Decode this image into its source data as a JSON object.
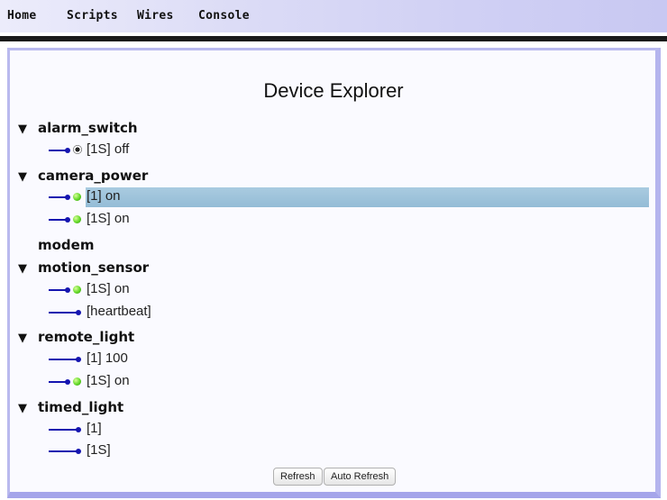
{
  "nav": {
    "items": [
      "Home",
      "Scripts",
      "Wires",
      "Console"
    ]
  },
  "page": {
    "title": "Device Explorer"
  },
  "devices": [
    {
      "name": "alarm_switch",
      "expanded": true,
      "channels": [
        {
          "label": "[1S] off",
          "indicator": "radio",
          "selected": false
        }
      ]
    },
    {
      "name": "camera_power",
      "expanded": true,
      "channels": [
        {
          "label": "[1] on",
          "indicator": "green",
          "selected": true
        },
        {
          "label": "[1S] on",
          "indicator": "green",
          "selected": false
        }
      ]
    },
    {
      "name": "modem",
      "expanded": false,
      "channels": []
    },
    {
      "name": "motion_sensor",
      "expanded": true,
      "channels": [
        {
          "label": "[1S] on",
          "indicator": "green",
          "selected": false
        },
        {
          "label": "[heartbeat]",
          "indicator": "none",
          "selected": false
        }
      ]
    },
    {
      "name": "remote_light",
      "expanded": true,
      "channels": [
        {
          "label": "[1] 100",
          "indicator": "none",
          "selected": false
        },
        {
          "label": "[1S] on",
          "indicator": "green",
          "selected": false
        }
      ]
    },
    {
      "name": "timed_light",
      "expanded": true,
      "channels": [
        {
          "label": "[1]",
          "indicator": "none",
          "selected": false
        },
        {
          "label": "[1S]",
          "indicator": "none",
          "selected": false
        }
      ]
    }
  ],
  "buttons": {
    "refresh": "Refresh",
    "auto_refresh": "Auto Refresh"
  },
  "colors": {
    "wire": "#1515b0",
    "selection": "#a9cbe0",
    "nav_bg": "#d8d8f6",
    "frame": "#b9b9ee"
  }
}
